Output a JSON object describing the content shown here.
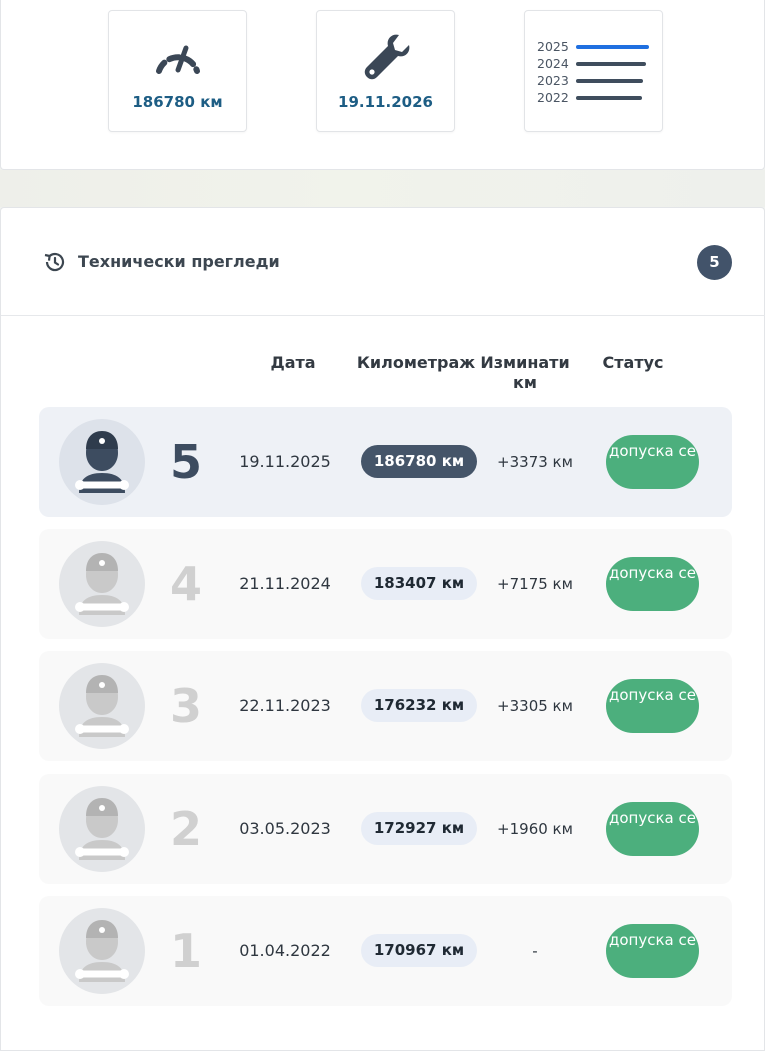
{
  "summary": {
    "mileage": "186780 км",
    "next_inspection": "19.11.2026",
    "years": [
      {
        "label": "2025",
        "level": 1.0,
        "color": "#1f6fe0"
      },
      {
        "label": "2024",
        "level": 0.96,
        "color": "#3f4d5d"
      },
      {
        "label": "2023",
        "level": 0.92,
        "color": "#3f4d5d"
      },
      {
        "label": "2022",
        "level": 0.9,
        "color": "#3f4d5d"
      }
    ]
  },
  "section": {
    "title": "Технически прегледи",
    "count": "5"
  },
  "table": {
    "headers": {
      "date": "Дата",
      "mileage": "Километраж",
      "change": "Изминати км",
      "status": "Статус"
    },
    "rows": [
      {
        "num": "5",
        "date": "19.11.2025",
        "km": "186780 км",
        "change": "+3373 км",
        "status": "допуска се",
        "active": true
      },
      {
        "num": "4",
        "date": "21.11.2024",
        "km": "183407 км",
        "change": "+7175 км",
        "status": "допуска се",
        "active": false
      },
      {
        "num": "3",
        "date": "22.11.2023",
        "km": "176232 км",
        "change": "+3305 км",
        "status": "допуска се",
        "active": false
      },
      {
        "num": "2",
        "date": "03.05.2023",
        "km": "172927 км",
        "change": "+1960 км",
        "status": "допуска се",
        "active": false
      },
      {
        "num": "1",
        "date": "01.04.2022",
        "km": "170967 км",
        "change": "-",
        "status": "допуска се",
        "active": false
      }
    ]
  },
  "colors": {
    "accent": "#1d5d84",
    "status_ok": "#4caf7d",
    "badge": "#42536a",
    "year_highlight": "#1f6fe0"
  },
  "icons": {
    "mileage": "speedometer-icon",
    "inspection": "wrench-icon",
    "history": "history-icon",
    "avatar": "mechanic-icon"
  }
}
